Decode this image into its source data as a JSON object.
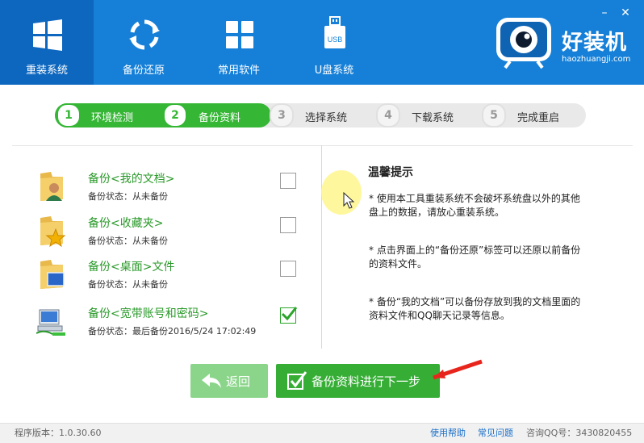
{
  "header": {
    "tabs": [
      {
        "label": "重装系统",
        "icon": "windows-icon",
        "active": true
      },
      {
        "label": "备份还原",
        "icon": "sync-icon",
        "active": false
      },
      {
        "label": "常用软件",
        "icon": "apps-grid-icon",
        "active": false
      },
      {
        "label": "U盘系统",
        "icon": "usb-icon",
        "active": false
      }
    ],
    "usb_icon_text": "USB",
    "window_controls": {
      "minimize": "–",
      "close": "✕"
    },
    "brand": {
      "name": "好装机",
      "url": "haozhuangji.com"
    }
  },
  "steps": [
    {
      "num": "1",
      "label": "环境检测",
      "done": true
    },
    {
      "num": "2",
      "label": "备份资料",
      "done": true
    },
    {
      "num": "3",
      "label": "选择系统",
      "done": false
    },
    {
      "num": "4",
      "label": "下载系统",
      "done": false
    },
    {
      "num": "5",
      "label": "完成重启",
      "done": false
    }
  ],
  "backup_items": [
    {
      "title": "备份<我的文档>",
      "status": "备份状态：从未备份",
      "checked": false,
      "icon": "documents-folder-icon"
    },
    {
      "title": "备份<收藏夹>",
      "status": "备份状态：从未备份",
      "checked": false,
      "icon": "favorites-folder-icon"
    },
    {
      "title": "备份<桌面>文件",
      "status": "备份状态：从未备份",
      "checked": false,
      "icon": "desktop-folder-icon"
    },
    {
      "title": "备份<宽带账号和密码>",
      "status": "备份状态：最后备份2016/5/24 17:02:49",
      "checked": true,
      "icon": "network-computer-icon"
    }
  ],
  "tips": {
    "title": "温馨提示",
    "items": [
      "* 使用本工具重装系统不会破坏系统盘以外的其他盘上的数据，请放心重装系统。",
      "* 点击界面上的“备份还原”标签可以还原以前备份的资料文件。",
      "* 备份“我的文档”可以备份存放到我的文档里面的资料文件和QQ聊天记录等信息。"
    ]
  },
  "buttons": {
    "back": "返回",
    "next": "备份资料进行下一步"
  },
  "footer": {
    "version": "程序版本：1.0.30.60",
    "links": [
      "使用帮助",
      "常见问题"
    ],
    "qq": "咨询QQ号：3430820455"
  },
  "colors": {
    "header": "#1680d8",
    "accent_green": "#36ae36",
    "title_green": "#2a9a2a",
    "link_blue": "#1a6fc9"
  }
}
